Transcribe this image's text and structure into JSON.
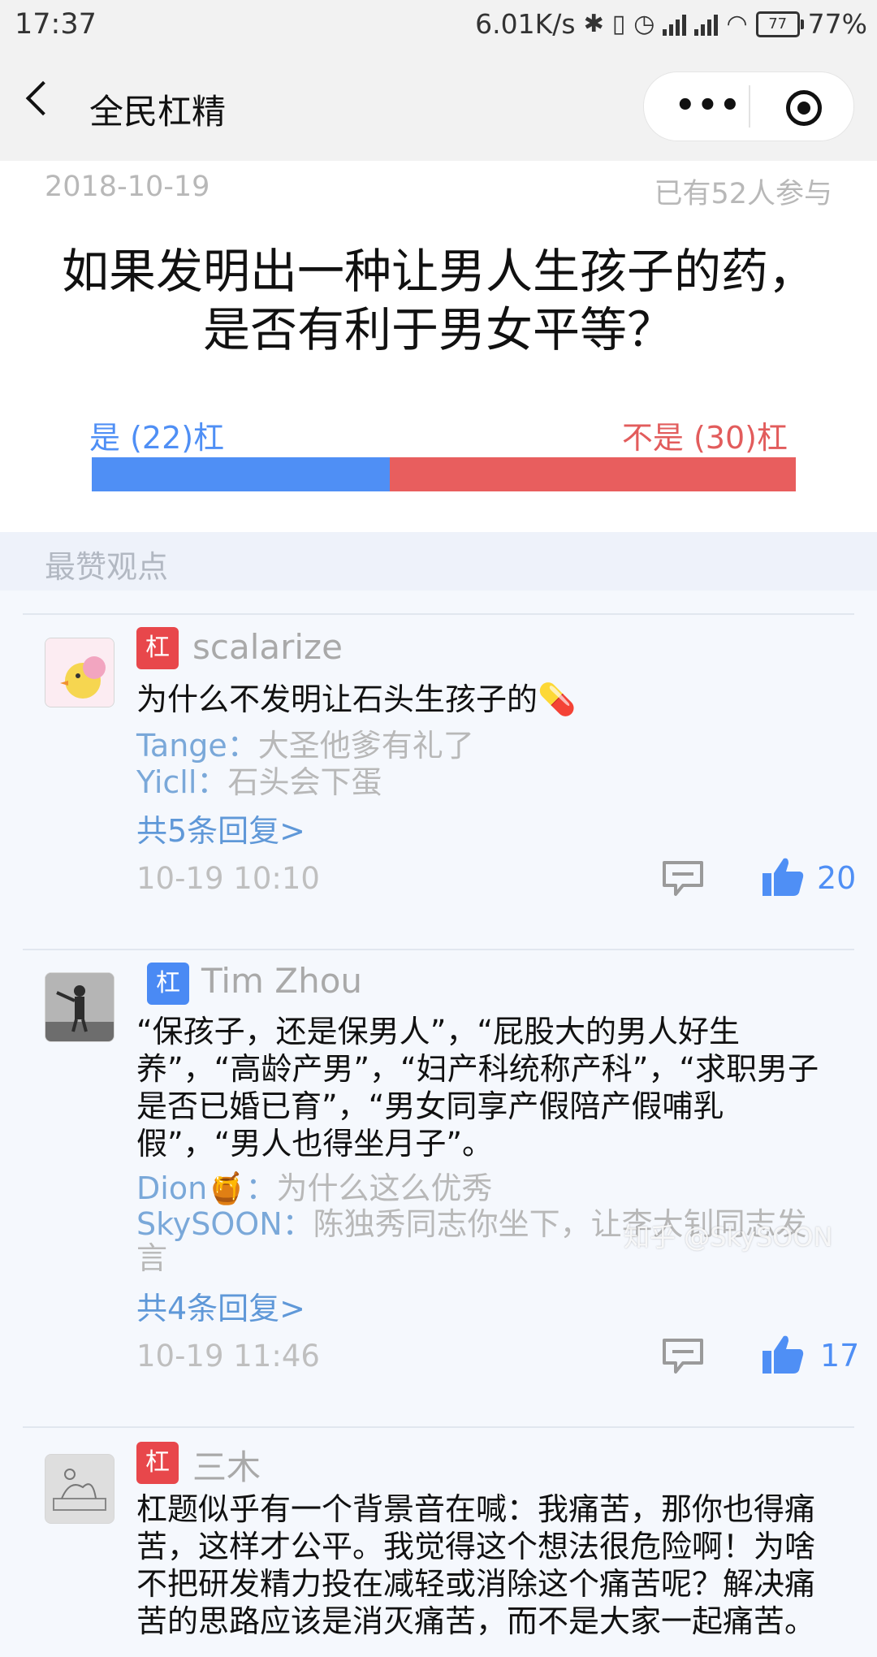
{
  "status": {
    "time": "17:37",
    "speed": "6.01K/s",
    "battery_level": "77",
    "battery_pct": "77%"
  },
  "nav": {
    "title": "全民杠精"
  },
  "topic": {
    "date": "2018-10-19",
    "participants": "已有52人参与",
    "question": "如果发明出一种让男人生孩子的药，是否有利于男女平等？",
    "yes_label": "是 (22)杠",
    "no_label": "不是 (30)杠",
    "yes_count": 22,
    "no_count": 30
  },
  "section": {
    "title": "最赞观点"
  },
  "comments": [
    {
      "user": "scalarize",
      "badge": "杠",
      "badge_color": "#e8474b",
      "text": "为什么不发明让石头生孩子的💊",
      "replies": [
        {
          "name": "Tange：",
          "text": "大圣他爹有礼了"
        },
        {
          "name": "Yicll：",
          "text": "石头会下蛋"
        }
      ],
      "more": "共5条回复>",
      "time": "10-19 10:10",
      "likes": "20"
    },
    {
      "user": "Tim Zhou",
      "badge": "杠",
      "badge_color": "#4a8af4",
      "text": "“保孩子，还是保男人”，“屁股大的男人好生养”，“高龄产男”，“妇产科统称产科”，“求职男子是否已婚已育”，“男女同享产假陪产假哺乳假”，“男人也得坐月子”。",
      "replies": [
        {
          "name": "Dion🍯：",
          "text": "为什么这么优秀"
        },
        {
          "name": "SkySOON：",
          "text": "陈独秀同志你坐下，让李大钊同志发言"
        }
      ],
      "more": "共4条回复>",
      "time": "10-19 11:46",
      "likes": "17"
    },
    {
      "user": "三木",
      "badge": "杠",
      "badge_color": "#e8474b",
      "text": "杠题似乎有一个背景音在喊：我痛苦，那你也得痛苦，这样才公平。我觉得这个想法很危险啊！为啥不把研发精力投在减轻或消除这个痛苦呢？解决痛苦的思路应该是消灭痛苦，而不是大家一起痛苦。"
    }
  ],
  "watermark": "知乎 @SkySOON"
}
